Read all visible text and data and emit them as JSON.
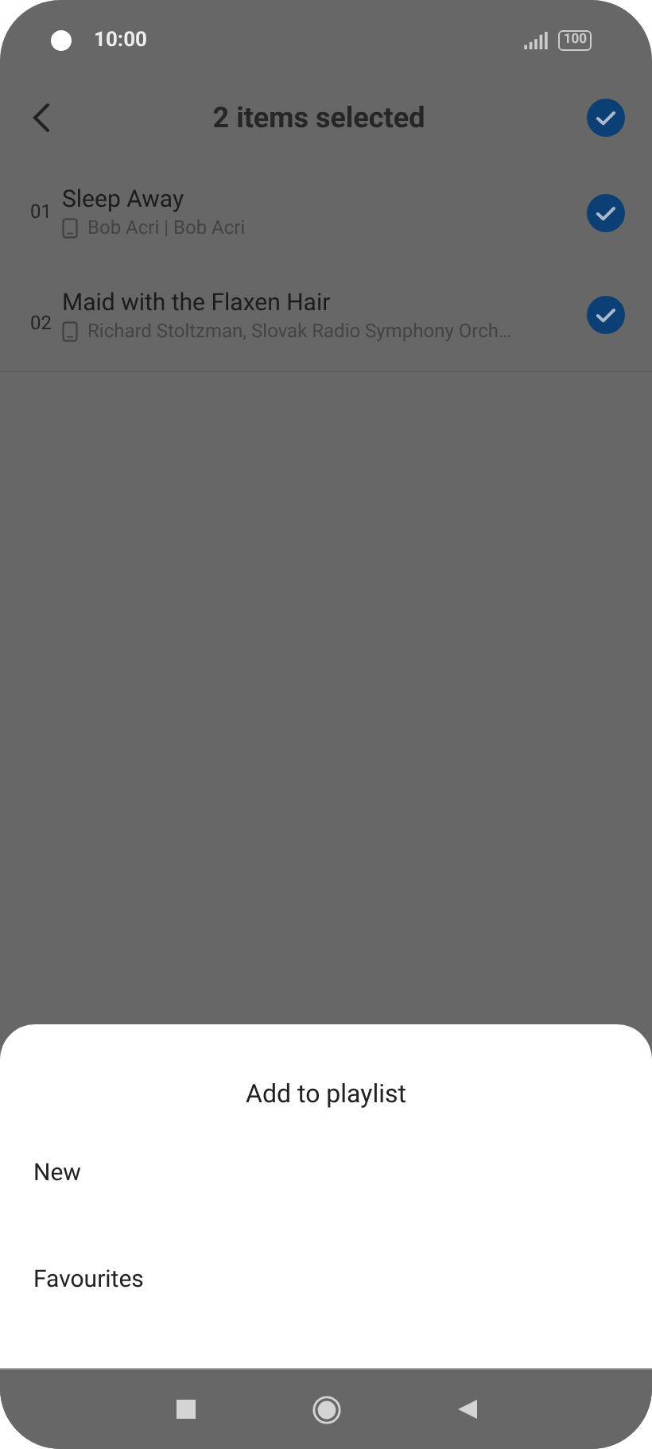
{
  "status_bar": {
    "time": "10:00",
    "battery": "100"
  },
  "header": {
    "title": "2 items selected",
    "all_selected": true
  },
  "songs": [
    {
      "number": "01",
      "title": "Sleep Away",
      "artist": "Bob Acri | Bob Acri",
      "selected": true
    },
    {
      "number": "02",
      "title": "Maid with the Flaxen Hair",
      "artist": "Richard Stoltzman, Slovak Radio Symphony Orch…",
      "selected": true
    }
  ],
  "sheet": {
    "title": "Add to playlist",
    "options": [
      "New",
      "Favourites"
    ]
  }
}
